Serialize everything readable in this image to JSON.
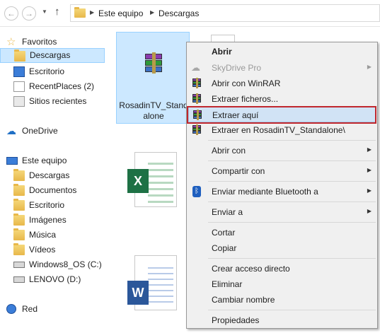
{
  "address_bar": {
    "crumbs": [
      "Este equipo",
      "Descargas"
    ]
  },
  "nav": {
    "favoritos": "Favoritos",
    "descargas": "Descargas",
    "escritorio": "Escritorio",
    "recentplaces": "RecentPlaces (2)",
    "sitios": "Sitios recientes",
    "onedrive": "OneDrive",
    "este_equipo": "Este equipo",
    "pc_descargas": "Descargas",
    "pc_documentos": "Documentos",
    "pc_escritorio": "Escritorio",
    "pc_imagenes": "Imágenes",
    "pc_musica": "Música",
    "pc_videos": "Vídeos",
    "pc_c": "Windows8_OS (C:)",
    "pc_d": "LENOVO (D:)",
    "red": "Red"
  },
  "files": {
    "rar_name_line1": "RosadinTV_Stand",
    "rar_name_line2": "alone",
    "excel_letter": "X",
    "word_letter": "W"
  },
  "menu": {
    "abrir": "Abrir",
    "skydrive": "SkyDrive Pro",
    "abrir_winrar": "Abrir con WinRAR",
    "extraer_ficheros": "Extraer ficheros...",
    "extraer_aqui": "Extraer aquí",
    "extraer_en": "Extraer en RosadinTV_Standalone\\",
    "abrir_con": "Abrir con",
    "compartir_con": "Compartir con",
    "bluetooth": "Enviar mediante Bluetooth a",
    "enviar_a": "Enviar a",
    "cortar": "Cortar",
    "copiar": "Copiar",
    "crear_acceso": "Crear acceso directo",
    "eliminar": "Eliminar",
    "cambiar_nombre": "Cambiar nombre",
    "propiedades": "Propiedades"
  },
  "colors": {
    "selection": "#cce8ff",
    "menu_highlight": "#d1e3f5",
    "annotation_red": "#c0272d"
  }
}
